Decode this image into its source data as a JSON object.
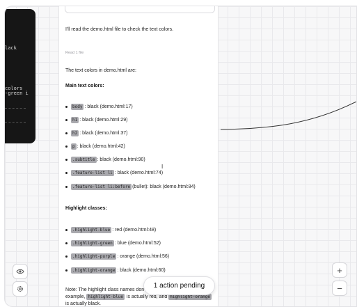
{
  "terminal": {
    "lines": [
      "lack",
      "colors",
      "-green i"
    ]
  },
  "chat": {
    "intro": "I'll read the demo.html file to check the text colors.",
    "tool_status": "Read 1 file",
    "summary": "The text colors in demo.html are:",
    "main_heading": "Main text colors:",
    "main_items": [
      {
        "code": "body",
        "text": ": black (demo.html:17)"
      },
      {
        "code": "h1",
        "text": ": black (demo.html:29)"
      },
      {
        "code": "h2",
        "text": ": black (demo.html:37)"
      },
      {
        "code": "p",
        "text": ": black (demo.html:42)"
      },
      {
        "code": ".subtitle",
        "text": ": black (demo.html:90)"
      },
      {
        "code": ".feature-list li",
        "text": ": black (demo.html:74)"
      },
      {
        "code": ".feature-list li:before",
        "text": " (bullet): black (demo.html:84)"
      }
    ],
    "highlight_heading": "Highlight classes:",
    "highlight_items": [
      {
        "code": ".highlight-blue",
        "text": ": red (demo.html:48)"
      },
      {
        "code": ".highlight-green",
        "text": ": blue (demo.html:52)"
      },
      {
        "code": ".highlight-purple",
        "text": ": orange (demo.html:56)"
      },
      {
        "code": ".highlight-orange",
        "text": ": black (demo.html:60)"
      }
    ],
    "note_start": "Note: The highlight class names don't m",
    "note_example": "example,",
    "note_code1": "highlight-blue",
    "note_mid": "is actually red, and",
    "note_code2": "highlight-orange",
    "note_end": "is actually black."
  },
  "pending": {
    "label": "1 action pending"
  },
  "controls": {
    "zoom_in": "+",
    "zoom_out": "−"
  },
  "colors": {
    "terminal_bg": "#161616",
    "code_bg": "#a9a9ae",
    "canvas_bg": "#f7f7f8"
  }
}
